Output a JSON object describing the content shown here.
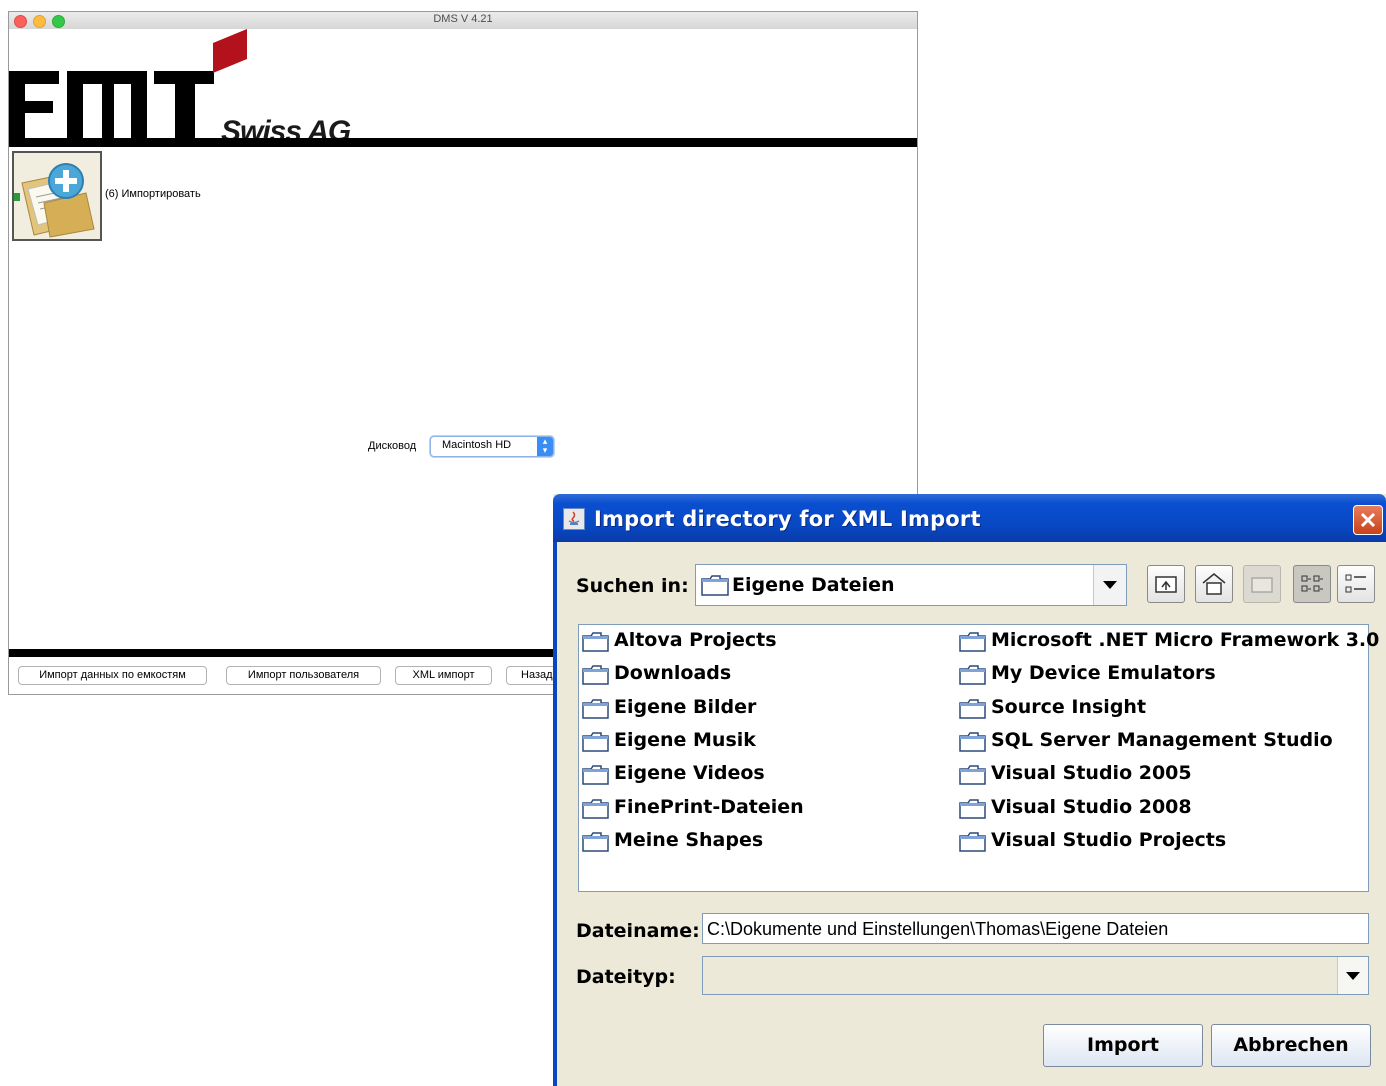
{
  "mac_window": {
    "title": "DMS V 4.21",
    "logo_text": "Swiss AG",
    "import_tile_label": "(6) Импортировать",
    "drive_label": "Дисковод",
    "drive_value": "Macintosh HD",
    "buttons": {
      "import_capacity": "Импорт данных по емкостям",
      "import_user": "Импорт пользователя",
      "xml_import": "XML импорт",
      "back": "Назад"
    }
  },
  "dialog": {
    "title": "Import directory for XML Import",
    "look_in_label": "Suchen in:",
    "look_in_value": "Eigene Dateien",
    "files_left": [
      "Altova Projects",
      "Downloads",
      "Eigene Bilder",
      "Eigene Musik",
      "Eigene Videos",
      "FinePrint-Dateien",
      "Meine Shapes"
    ],
    "files_right": [
      "Microsoft .NET Micro Framework 3.0",
      "My Device Emulators",
      "Source Insight",
      "SQL Server Management Studio",
      "Visual Studio 2005",
      "Visual Studio 2008",
      "Visual Studio Projects"
    ],
    "filename_label": "Dateiname:",
    "filename_value": "C:\\Dokumente und Einstellungen\\Thomas\\Eigene Dateien",
    "filetype_label": "Dateityp:",
    "filetype_value": "",
    "import_button": "Import",
    "cancel_button": "Abbrechen"
  },
  "colors": {
    "logo_red": "#b3121c",
    "xp_title_blue": "#0847c1",
    "xp_close_red": "#c9431a",
    "mac_select_blue": "#3b8cf5"
  }
}
